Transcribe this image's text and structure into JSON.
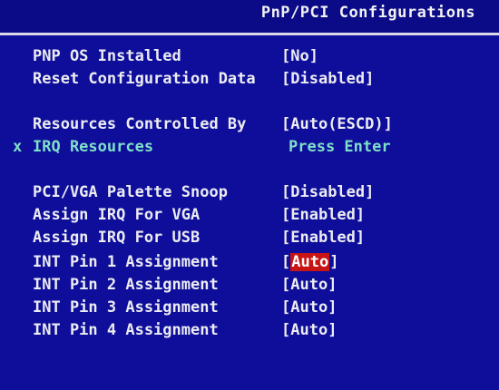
{
  "header": {
    "title": "PnP/PCI Configurations"
  },
  "items": [
    {
      "label": "PNP OS Installed",
      "value_open": "[",
      "value": "No",
      "value_close": "]"
    },
    {
      "label": "Reset Configuration Data",
      "value_open": "[",
      "value": "Disabled",
      "value_close": "]"
    },
    {
      "label": "Resources Controlled By",
      "value_open": "[",
      "value": "Auto(ESCD)",
      "value_close": "]"
    },
    {
      "marker": "x",
      "label": "IRQ Resources",
      "value": "Press Enter"
    },
    {
      "label": "PCI/VGA Palette Snoop",
      "value_open": "[",
      "value": "Disabled",
      "value_close": "]"
    },
    {
      "label": "Assign IRQ For VGA",
      "value_open": "[",
      "value": "Enabled",
      "value_close": "]"
    },
    {
      "label": "Assign IRQ For USB",
      "value_open": "[",
      "value": "Enabled",
      "value_close": "]"
    },
    {
      "label": "INT Pin 1 Assignment",
      "value_open": "[",
      "value": "Auto",
      "value_close": "]"
    },
    {
      "label": "INT Pin 2 Assignment",
      "value_open": "[",
      "value": "Auto",
      "value_close": "]"
    },
    {
      "label": "INT Pin 3 Assignment",
      "value_open": "[",
      "value": "Auto",
      "value_close": "]"
    },
    {
      "label": "INT Pin 4 Assignment",
      "value_open": "[",
      "value": "Auto",
      "value_close": "]"
    }
  ],
  "colors": {
    "background": "#0e0e9a",
    "text": "#ececf2",
    "submenu_text": "#7fe0c8",
    "selection": "#c81414"
  }
}
